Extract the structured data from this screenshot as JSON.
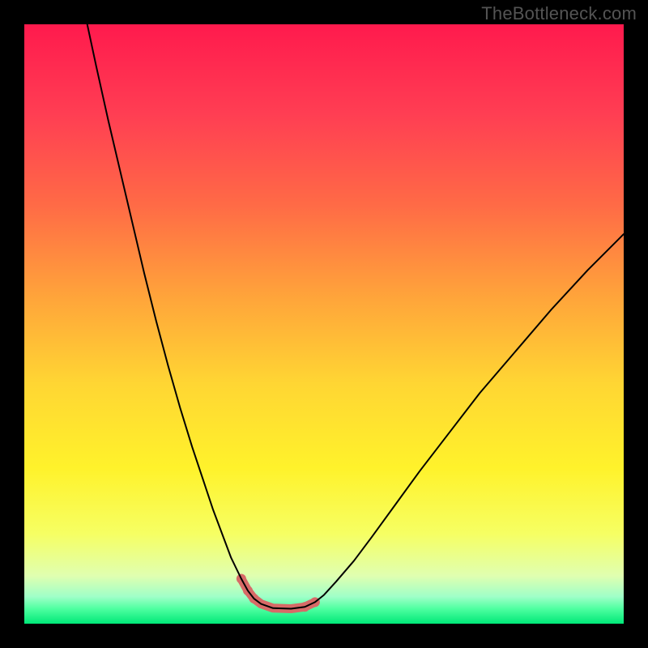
{
  "watermark": "TheBottleneck.com",
  "chart_data": {
    "type": "line",
    "title": "",
    "xlabel": "",
    "ylabel": "",
    "xlim": [
      0,
      100
    ],
    "ylim": [
      0,
      100
    ],
    "grid": false,
    "legend": false,
    "background_gradient_stops": [
      {
        "offset": 0.0,
        "color": "#ff1a4d"
      },
      {
        "offset": 0.15,
        "color": "#ff3e53"
      },
      {
        "offset": 0.3,
        "color": "#ff6a46"
      },
      {
        "offset": 0.46,
        "color": "#ffa63a"
      },
      {
        "offset": 0.6,
        "color": "#ffd633"
      },
      {
        "offset": 0.74,
        "color": "#fff22b"
      },
      {
        "offset": 0.85,
        "color": "#f6ff63"
      },
      {
        "offset": 0.92,
        "color": "#e0ffb0"
      },
      {
        "offset": 0.955,
        "color": "#9fffc8"
      },
      {
        "offset": 0.975,
        "color": "#4fffa0"
      },
      {
        "offset": 1.0,
        "color": "#00e878"
      }
    ],
    "series": [
      {
        "name": "bottleneck-curve",
        "stroke": "#000000",
        "stroke_width": 2.0,
        "x": [
          10.5,
          12,
          14,
          16,
          18,
          20,
          22,
          24,
          26,
          28,
          30,
          31.5,
          33,
          34.5,
          36.2,
          37.3,
          38.3,
          39.5,
          41.5,
          44.5,
          46.8,
          48.5,
          50,
          52,
          55,
          58,
          62,
          66,
          71,
          76,
          82,
          88,
          94,
          100
        ],
        "y": [
          100,
          93,
          84,
          75.5,
          67,
          58.5,
          50.5,
          43,
          36,
          29.5,
          23.5,
          19,
          15,
          11,
          7.5,
          5.5,
          4.2,
          3.3,
          2.6,
          2.5,
          2.8,
          3.6,
          4.8,
          7,
          10.5,
          14.5,
          20,
          25.5,
          32,
          38.5,
          45.5,
          52.5,
          59,
          65
        ]
      },
      {
        "name": "marker-band",
        "stroke": "#d76a67",
        "stroke_width": 11,
        "linecap": "round",
        "x": [
          36.2,
          37.3,
          38.3,
          39.5,
          41.5,
          44.5,
          46.8,
          48.5
        ],
        "y": [
          7.5,
          5.5,
          4.2,
          3.3,
          2.6,
          2.5,
          2.8,
          3.6
        ]
      }
    ],
    "marker_dots": {
      "color": "#d76a67",
      "radius": 6,
      "points": [
        {
          "x": 36.2,
          "y": 7.5
        },
        {
          "x": 37.3,
          "y": 5.5
        },
        {
          "x": 38.3,
          "y": 4.2
        },
        {
          "x": 46.8,
          "y": 2.8
        },
        {
          "x": 48.5,
          "y": 3.6
        }
      ]
    }
  }
}
